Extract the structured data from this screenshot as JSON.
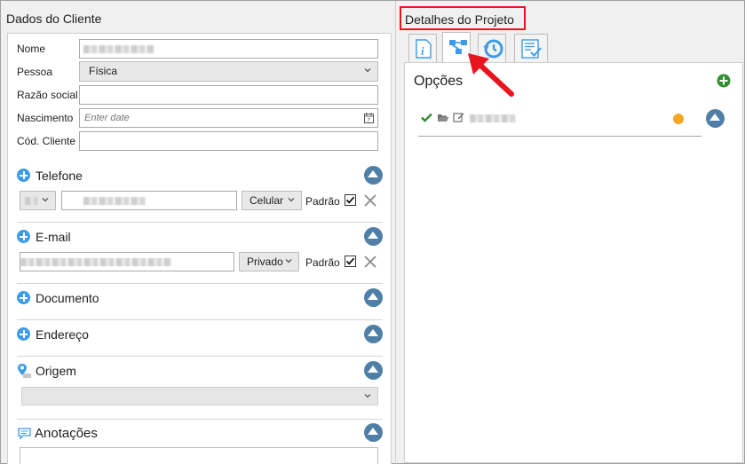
{
  "colors": {
    "accent_blue": "#3d9be9",
    "collapse_blue": "#4f7fa6",
    "highlight_red": "#e8141e",
    "add_green": "#2f8f2f",
    "status_orange": "#f5a623"
  },
  "left_panel": {
    "title": "Dados do Cliente",
    "fields": {
      "nome_label": "Nome",
      "pessoa_label": "Pessoa",
      "pessoa_value": "Física",
      "razao_label": "Razão social",
      "nascimento_label": "Nascimento",
      "nascimento_placeholder": "Enter date",
      "cod_label": "Cód. Cliente"
    },
    "sections": {
      "telefone": {
        "title": "Telefone",
        "type_value": "Celular",
        "default_label": "Padrão",
        "default_checked": true
      },
      "email": {
        "title": "E-mail",
        "type_value": "Privado",
        "default_label": "Padrão",
        "default_checked": true
      },
      "documento": {
        "title": "Documento"
      },
      "endereco": {
        "title": "Endereço"
      },
      "origem": {
        "title": "Origem"
      },
      "anotacoes": {
        "title": "Anotações"
      }
    }
  },
  "right_panel": {
    "title": "Detalhes do Projeto",
    "tabs": [
      {
        "icon": "info-icon"
      },
      {
        "icon": "workflow-icon",
        "active": true
      },
      {
        "icon": "history-icon"
      },
      {
        "icon": "checklist-icon"
      }
    ],
    "options_title": "Opções"
  }
}
